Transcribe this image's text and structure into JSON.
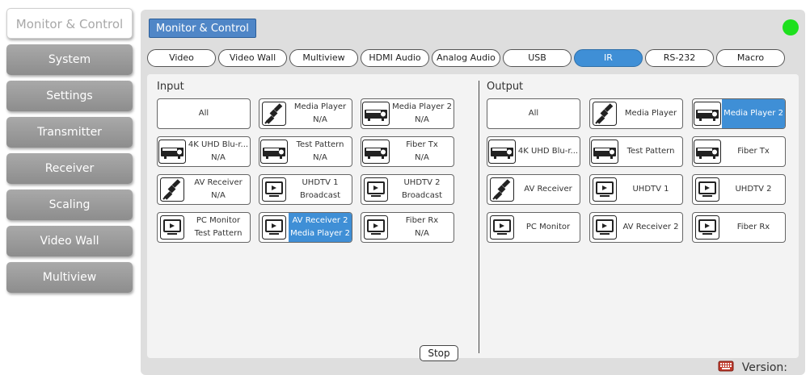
{
  "sidebar": {
    "items": [
      {
        "label": "Monitor & Control",
        "active": true
      },
      {
        "label": "System"
      },
      {
        "label": "Settings"
      },
      {
        "label": "Transmitter"
      },
      {
        "label": "Receiver"
      },
      {
        "label": "Scaling"
      },
      {
        "label": "Video Wall"
      },
      {
        "label": "Multiview"
      }
    ]
  },
  "page": {
    "title": "Monitor & Control",
    "status_color": "#1ee01e"
  },
  "tabs": [
    {
      "label": "Video"
    },
    {
      "label": "Video Wall"
    },
    {
      "label": "Multiview"
    },
    {
      "label": "HDMI Audio"
    },
    {
      "label": "Analog Audio"
    },
    {
      "label": "USB"
    },
    {
      "label": "IR",
      "active": true
    },
    {
      "label": "RS-232"
    },
    {
      "label": "Macro"
    }
  ],
  "input": {
    "label": "Input",
    "devices": [
      {
        "name": "All",
        "status": ""
      },
      {
        "name": "Media Player",
        "status": "N/A",
        "icon": "satellite-icon"
      },
      {
        "name": "Media Player 2",
        "status": "N/A",
        "icon": "projector-icon"
      },
      {
        "name": "4K UHD Blu-r...",
        "status": "N/A",
        "icon": "projector-icon"
      },
      {
        "name": "Test Pattern",
        "status": "N/A",
        "icon": "projector-icon"
      },
      {
        "name": "Fiber Tx",
        "status": "N/A",
        "icon": "projector-icon"
      },
      {
        "name": "AV Receiver",
        "status": "N/A",
        "icon": "satellite-icon"
      },
      {
        "name": "UHDTV 1",
        "status": "Broadcast",
        "icon": "monitor-icon"
      },
      {
        "name": "UHDTV 2",
        "status": "Broadcast",
        "icon": "monitor-icon"
      },
      {
        "name": "PC Monitor",
        "status": "Test Pattern",
        "icon": "monitor-icon"
      },
      {
        "name": "AV Receiver 2",
        "status": "Media Player 2",
        "icon": "monitor-icon",
        "selected": true
      },
      {
        "name": "Fiber Rx",
        "status": "N/A",
        "icon": "monitor-icon"
      }
    ],
    "stop_label": "Stop"
  },
  "output": {
    "label": "Output",
    "devices": [
      {
        "name": "All"
      },
      {
        "name": "Media Player",
        "icon": "satellite-icon"
      },
      {
        "name": "Media Player 2",
        "icon": "projector-icon",
        "selected": true
      },
      {
        "name": "4K UHD Blu-r...",
        "icon": "projector-icon"
      },
      {
        "name": "Test Pattern",
        "icon": "projector-icon"
      },
      {
        "name": "Fiber Tx",
        "icon": "projector-icon"
      },
      {
        "name": "AV Receiver",
        "icon": "satellite-icon"
      },
      {
        "name": "UHDTV 1",
        "icon": "monitor-icon"
      },
      {
        "name": "UHDTV 2",
        "icon": "monitor-icon"
      },
      {
        "name": "PC Monitor",
        "icon": "monitor-icon"
      },
      {
        "name": "AV Receiver 2",
        "icon": "monitor-icon"
      },
      {
        "name": "Fiber Rx",
        "icon": "monitor-icon"
      }
    ]
  },
  "footer": {
    "version_label": "Version:",
    "icon": "keyboard-icon"
  },
  "colors": {
    "accent": "#3f8fd6",
    "title_bg": "#4f86c7",
    "sidebar": "#9a9a9a"
  }
}
